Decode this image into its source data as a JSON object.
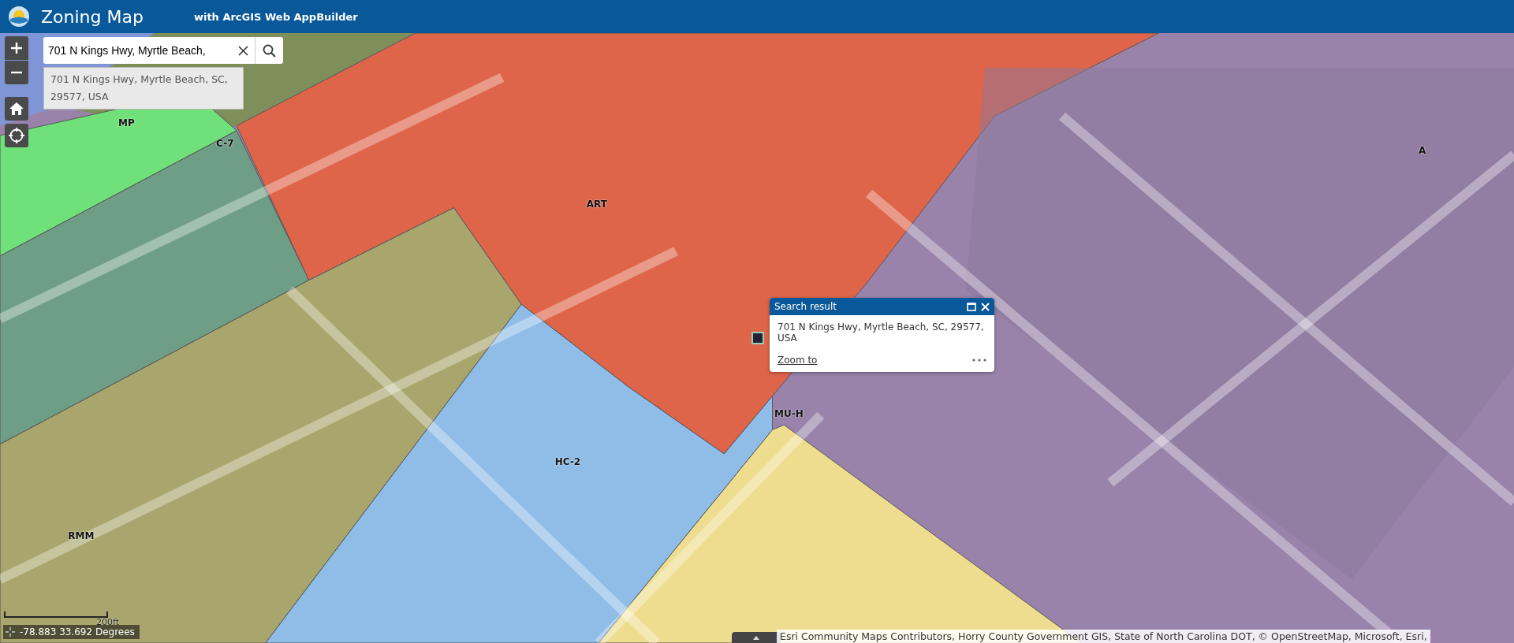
{
  "header": {
    "title": "Zoning Map",
    "subtitle": "with ArcGIS Web AppBuilder"
  },
  "search": {
    "value": "701 N Kings Hwy, Myrtle Beach,",
    "suggestion": "701 N Kings Hwy, Myrtle Beach, SC, 29577, USA"
  },
  "zones": [
    {
      "label": "A",
      "color": "#9a83ab"
    },
    {
      "label": "MP",
      "color": "#6fe07a"
    },
    {
      "label": "C-7",
      "color": "#6f9e86"
    },
    {
      "label": "ART",
      "color": "#de654a"
    },
    {
      "label": "RMM",
      "color": "#a9a66d"
    },
    {
      "label": "HC-2",
      "color": "#8fbde8"
    },
    {
      "label": "MU-H",
      "color": "#eedd8e"
    }
  ],
  "popup": {
    "title": "Search result",
    "content": "701 N Kings Hwy, Myrtle Beach, SC, 29577, USA",
    "link": "Zoom to"
  },
  "scale": "200ft",
  "coordinates": "-78.883 33.692 Degrees",
  "attribution": "Esri Community Maps Contributors, Horry County Government GIS, State of North Carolina DOT, © OpenStreetMap, Microsoft, Esri,"
}
